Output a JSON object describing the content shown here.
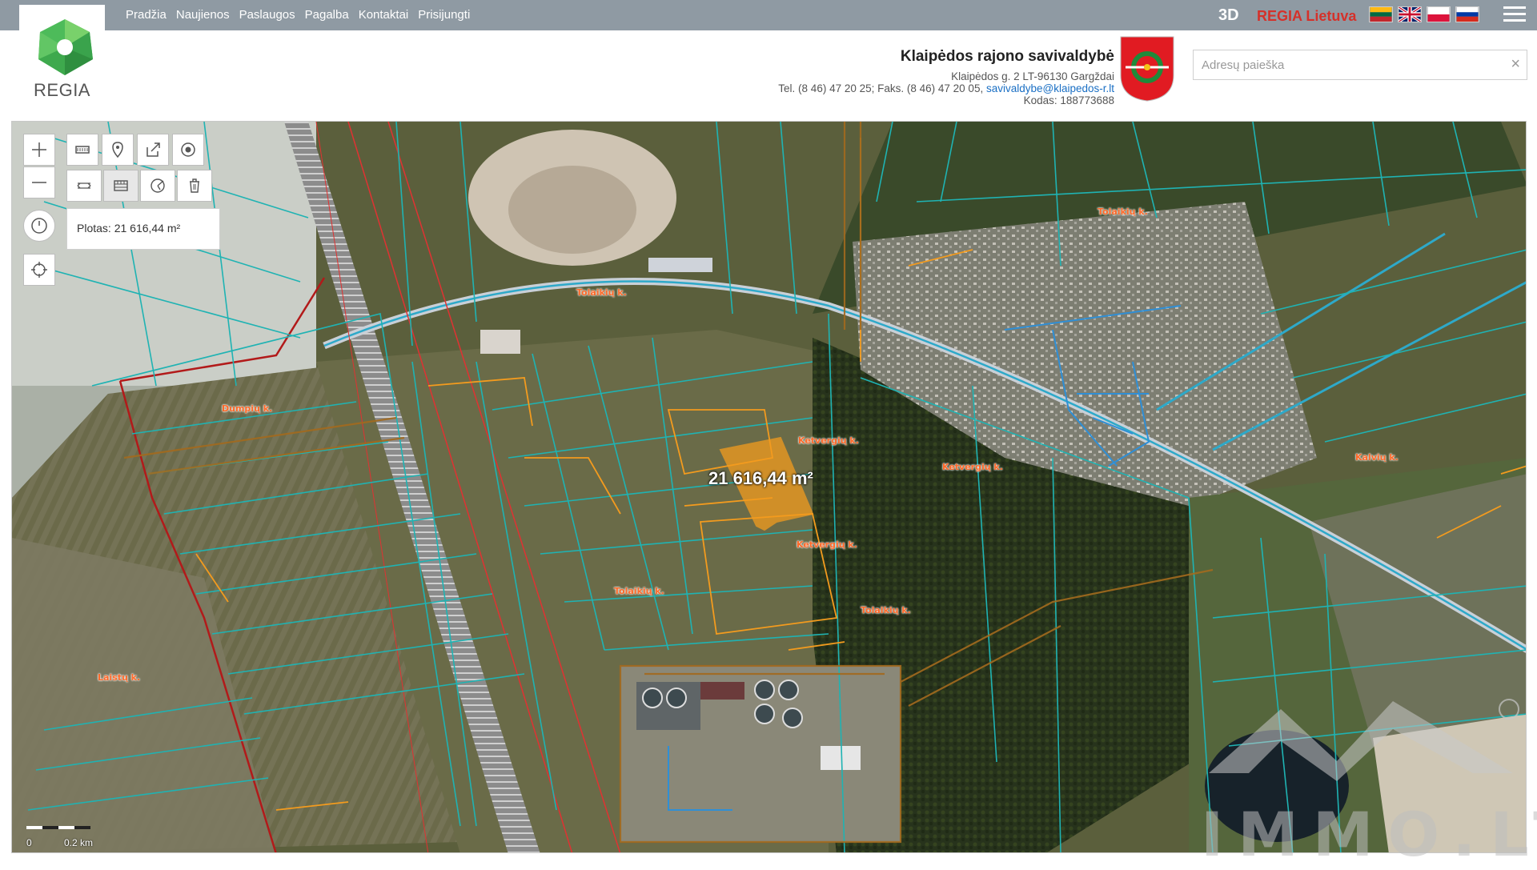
{
  "nav": {
    "items": [
      "Pradžia",
      "Naujienos",
      "Paslaugos",
      "Pagalba",
      "Kontaktai",
      "Prisijungti"
    ],
    "btn_3d": "3D",
    "brand_link": "REGIA Lietuva",
    "flags": [
      "lt-flag-icon",
      "uk-flag-icon",
      "pl-flag-icon",
      "ru-flag-icon"
    ]
  },
  "logo": {
    "text": "REGIA"
  },
  "municipality": {
    "title": "Klaipėdos rajono savivaldybė",
    "address": "Klaipėdos g. 2 LT-96130 Gargždai",
    "phones": "Tel. (8 46) 47 20 25; Faks. (8 46) 47 20 05,",
    "email": "savivaldybe@klaipedos-r.lt",
    "code": "Kodas: 188773688"
  },
  "search": {
    "placeholder": "Adresų paieška",
    "clear_icon": "×"
  },
  "map": {
    "measure_panel": "Plotas: 21 616,44 m²",
    "measure_label": "21 616,44 m²",
    "scale": {
      "zero": "0",
      "distance": "0.2 km"
    },
    "places": [
      {
        "name": "Dumpių k."
      },
      {
        "name": "Ketvergių k."
      },
      {
        "name": "Ketvergių k."
      },
      {
        "name": "Ketvergių k."
      },
      {
        "name": "Tolaikių k."
      },
      {
        "name": "Tolaikių k."
      },
      {
        "name": "Tolaikių k."
      },
      {
        "name": "Laistų k."
      },
      {
        "name": "Kalvių k."
      },
      {
        "name": "Tolaikių k."
      }
    ],
    "watermark": "IMMO.LT"
  },
  "colors": {
    "topbar": "#8f9aa3",
    "brand_red": "#d5312a",
    "cadastre": "#1fb3b3",
    "orange": "#f39b1e",
    "selection": "#f39b1e"
  }
}
